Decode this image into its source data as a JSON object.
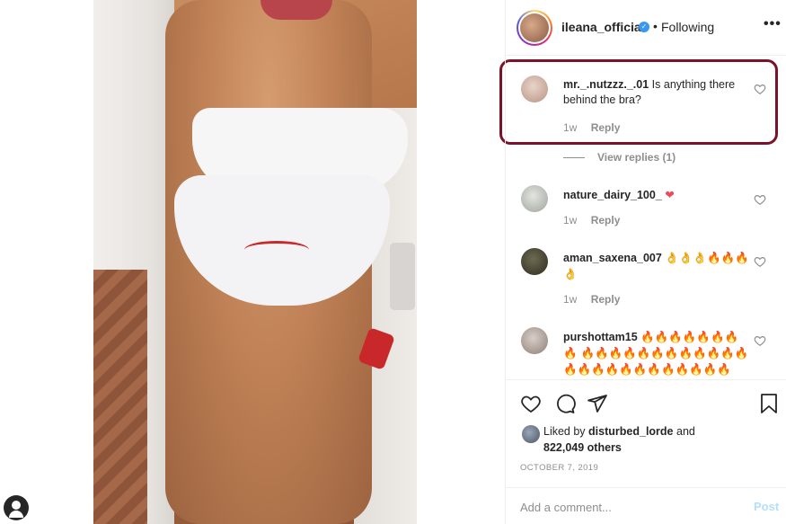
{
  "post": {
    "owner": "ileana_official",
    "separator": "•",
    "follow_state": "Following",
    "more_label": "•••"
  },
  "comments": [
    {
      "user": "mr._.nutzzz._.01",
      "text": "Is anything there behind the bra?",
      "age": "1w",
      "reply": "Reply"
    },
    {
      "user": "nature_dairy_100_",
      "text": "❤",
      "age": "1w",
      "reply": "Reply"
    },
    {
      "user": "aman_saxena_007",
      "text": "👌👌👌🔥🔥🔥 👌",
      "age": "1w",
      "reply": "Reply"
    },
    {
      "user": "purshottam15",
      "text": "🔥🔥🔥🔥🔥🔥🔥🔥 🔥🔥🔥🔥🔥🔥🔥🔥🔥🔥🔥🔥 🔥🔥🔥🔥🔥🔥🔥🔥🔥🔥🔥🔥"
    }
  ],
  "view_replies": "View replies (1)",
  "likes": {
    "prefix": "Liked by",
    "user": "disturbed_lorde",
    "conj": "and",
    "count": "822,049 others"
  },
  "date": "OCTOBER 7, 2019",
  "add_comment": {
    "placeholder": "Add a comment...",
    "post_label": "Post"
  },
  "colors": {
    "highlight": "#7a1328",
    "verified": "#3897f0",
    "post_disabled": "#b2dffc",
    "heart": "#ed4956"
  },
  "icons": [
    "heart-icon",
    "comment-icon",
    "share-icon",
    "bookmark-icon",
    "verified-icon",
    "more-icon",
    "profile-icon"
  ]
}
